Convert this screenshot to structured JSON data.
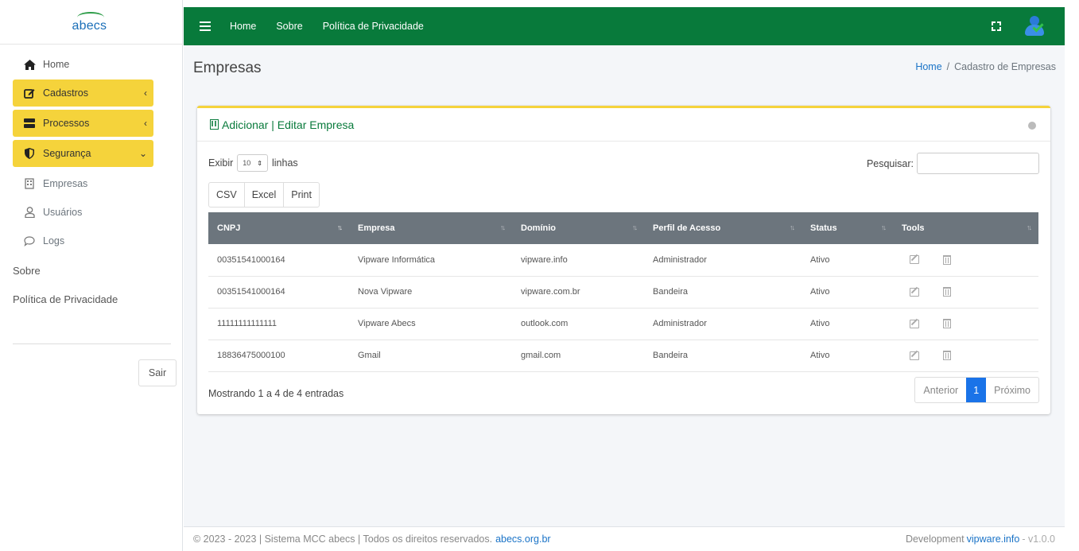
{
  "brand": {
    "name": "abecs"
  },
  "sidebar": {
    "items": [
      {
        "label": "Home",
        "icon": "home-icon"
      },
      {
        "label": "Cadastros",
        "icon": "edit-icon"
      },
      {
        "label": "Processos",
        "icon": "server-icon"
      },
      {
        "label": "Segurança",
        "icon": "shield-icon"
      },
      {
        "label": "Empresas",
        "icon": "building-icon"
      },
      {
        "label": "Usuários",
        "icon": "user-icon"
      },
      {
        "label": "Logs",
        "icon": "chat-icon"
      }
    ],
    "sobre": "Sobre",
    "privacidade": "Política de Privacidade",
    "sair": "Sair"
  },
  "topnav": {
    "home": "Home",
    "sobre": "Sobre",
    "privacidade": "Política de Privacidade"
  },
  "page": {
    "title": "Empresas",
    "breadcrumb_home": "Home",
    "breadcrumb_sep": "/",
    "breadcrumb_current": "Cadastro de Empresas"
  },
  "card": {
    "title": "Adicionar | Editar Empresa",
    "exibir": "Exibir",
    "page_size": "10",
    "linhas": "linhas",
    "pesquisar": "Pesquisar:",
    "buttons": [
      "CSV",
      "Excel",
      "Print"
    ]
  },
  "table": {
    "headers": [
      "CNPJ",
      "Empresa",
      "Domínio",
      "Perfil de Acesso",
      "Status",
      "Tools"
    ],
    "rows": [
      [
        "00351541000164",
        "Vipware Informática",
        "vipware.info",
        "Administrador",
        "Ativo"
      ],
      [
        "00351541000164",
        "Nova Vipware",
        "vipware.com.br",
        "Bandeira",
        "Ativo"
      ],
      [
        "11111111111111",
        "Vipware Abecs",
        "outlook.com",
        "Administrador",
        "Ativo"
      ],
      [
        "18836475000100",
        "Gmail",
        "gmail.com",
        "Bandeira",
        "Ativo"
      ]
    ]
  },
  "pagination": {
    "info": "Mostrando 1 a 4 de 4 entradas",
    "prev": "Anterior",
    "current": "1",
    "next": "Próximo"
  },
  "footer": {
    "text": "© 2023 - 2023 | Sistema MCC abecs | Todos os direitos reservados.",
    "link": "abecs.org.br",
    "dev": "Development",
    "dev_link": "vipware.info",
    "version": "- v1.0.0"
  },
  "colors": {
    "primary": "#087a3b",
    "highlight": "#f5d33b",
    "link": "#1a73c7"
  }
}
